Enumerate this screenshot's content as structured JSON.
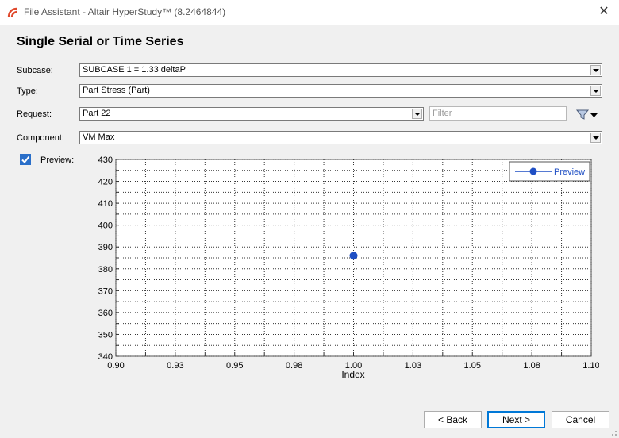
{
  "window": {
    "title": "File Assistant - Altair HyperStudy™ (8.2464844)",
    "app_icon": "altair-logo-icon",
    "close_glyph": "✕"
  },
  "page": {
    "heading": "Single Serial or Time Series"
  },
  "form": {
    "subcase_label": "Subcase:",
    "subcase_value": "SUBCASE 1 = 1.33 deltaP",
    "type_label": "Type:",
    "type_value": "Part Stress (Part)",
    "request_label": "Request:",
    "request_value": "Part 22",
    "filter_placeholder": "Filter",
    "filter_value": "",
    "component_label": "Component:",
    "component_value": "VM Max",
    "preview_label": "Preview:",
    "preview_checked": true
  },
  "chart_data": {
    "type": "scatter",
    "xlabel": "Index",
    "ylabel": "",
    "xlim": [
      0.9,
      1.1
    ],
    "ylim": [
      340,
      430
    ],
    "xticks": [
      "0.90",
      "0.93",
      "0.95",
      "0.98",
      "1.00",
      "1.03",
      "1.05",
      "1.08",
      "1.10"
    ],
    "yticks": [
      "430",
      "420",
      "410",
      "400",
      "390",
      "380",
      "370",
      "360",
      "350",
      "340"
    ],
    "grid": true,
    "legend_position": "top-right",
    "series": [
      {
        "name": "Preview",
        "color": "#1f4fc4",
        "x": [
          1.0
        ],
        "y": [
          386
        ]
      }
    ]
  },
  "buttons": {
    "back": "< Back",
    "next": "Next >",
    "cancel": "Cancel"
  }
}
